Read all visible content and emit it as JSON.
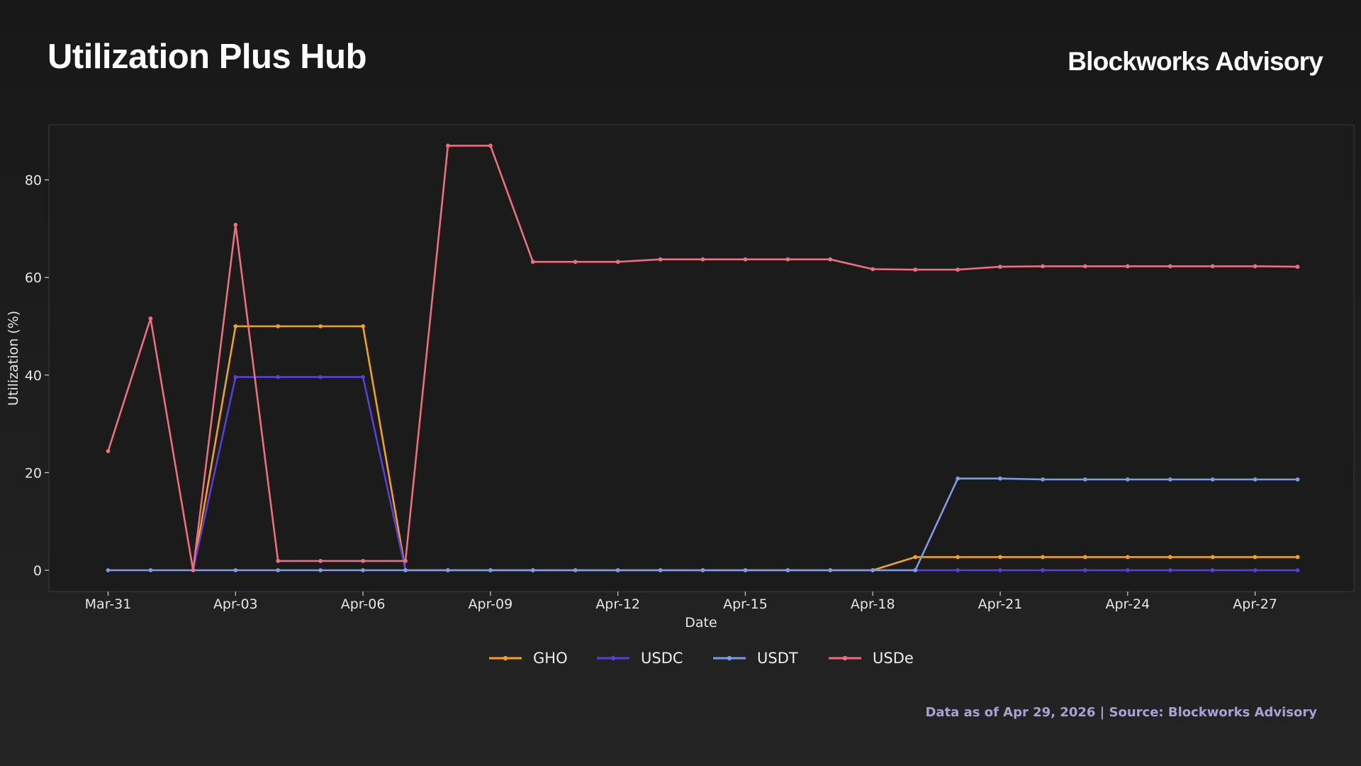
{
  "header": {
    "title": "Utilization Plus Hub",
    "brand": "Blockworks Advisory"
  },
  "footer": {
    "source_note": "Data as of Apr 29, 2026 | Source: Blockworks Advisory"
  },
  "colors": {
    "GHO": "#f0a31c",
    "USDC": "#5b3ed6",
    "USDT": "#7c9de6",
    "USDe": "#ec6f7e"
  },
  "chart_data": {
    "type": "line",
    "xlabel": "Date",
    "ylabel": "Utilization (%)",
    "ylim": [
      -4.3,
      91
    ],
    "yticks": [
      0,
      20,
      40,
      60,
      80
    ],
    "xticks": [
      {
        "label": "Mar-31",
        "date": "2026-03-31"
      },
      {
        "label": "Apr-03",
        "date": "2026-04-03"
      },
      {
        "label": "Apr-06",
        "date": "2026-04-06"
      },
      {
        "label": "Apr-09",
        "date": "2026-04-09"
      },
      {
        "label": "Apr-12",
        "date": "2026-04-12"
      },
      {
        "label": "Apr-15",
        "date": "2026-04-15"
      },
      {
        "label": "Apr-18",
        "date": "2026-04-18"
      },
      {
        "label": "Apr-21",
        "date": "2026-04-21"
      },
      {
        "label": "Apr-24",
        "date": "2026-04-24"
      },
      {
        "label": "Apr-27",
        "date": "2026-04-27"
      }
    ],
    "x": [
      "2026-03-31",
      "2026-04-01",
      "2026-04-02",
      "2026-04-03",
      "2026-04-04",
      "2026-04-05",
      "2026-04-06",
      "2026-04-07",
      "2026-04-08",
      "2026-04-09",
      "2026-04-10",
      "2026-04-11",
      "2026-04-12",
      "2026-04-13",
      "2026-04-14",
      "2026-04-15",
      "2026-04-16",
      "2026-04-17",
      "2026-04-18",
      "2026-04-19",
      "2026-04-20",
      "2026-04-21",
      "2026-04-22",
      "2026-04-23",
      "2026-04-24",
      "2026-04-25",
      "2026-04-26",
      "2026-04-27",
      "2026-04-28"
    ],
    "grid": false,
    "legend": "bottom-center",
    "series": [
      {
        "name": "GHO",
        "x": [
          "2026-04-02",
          "2026-04-03",
          "2026-04-04",
          "2026-04-05",
          "2026-04-06",
          "2026-04-07",
          "2026-04-08",
          "2026-04-09",
          "2026-04-10",
          "2026-04-11",
          "2026-04-12",
          "2026-04-13",
          "2026-04-14",
          "2026-04-15",
          "2026-04-16",
          "2026-04-17",
          "2026-04-18",
          "2026-04-19",
          "2026-04-20",
          "2026-04-21",
          "2026-04-22",
          "2026-04-23",
          "2026-04-24",
          "2026-04-25",
          "2026-04-26",
          "2026-04-27",
          "2026-04-28"
        ],
        "values": [
          0,
          50,
          50,
          50,
          50,
          0,
          0,
          0,
          0,
          0,
          0,
          0,
          0,
          0,
          0,
          0,
          0,
          2.7,
          2.7,
          2.7,
          2.7,
          2.7,
          2.7,
          2.7,
          2.7,
          2.7,
          2.7
        ]
      },
      {
        "name": "USDC",
        "x": [
          "2026-04-02",
          "2026-04-03",
          "2026-04-04",
          "2026-04-05",
          "2026-04-06",
          "2026-04-07",
          "2026-04-08",
          "2026-04-09",
          "2026-04-10",
          "2026-04-11",
          "2026-04-12",
          "2026-04-13",
          "2026-04-14",
          "2026-04-15",
          "2026-04-16",
          "2026-04-17",
          "2026-04-18",
          "2026-04-19",
          "2026-04-20",
          "2026-04-21",
          "2026-04-22",
          "2026-04-23",
          "2026-04-24",
          "2026-04-25",
          "2026-04-26",
          "2026-04-27",
          "2026-04-28"
        ],
        "values": [
          0,
          39.6,
          39.6,
          39.6,
          39.6,
          0,
          0,
          0,
          0,
          0,
          0,
          0,
          0,
          0,
          0,
          0,
          0,
          0,
          0,
          0,
          0,
          0,
          0,
          0,
          0,
          0,
          0
        ]
      },
      {
        "name": "USDT",
        "x": [
          "2026-03-31",
          "2026-04-01",
          "2026-04-02",
          "2026-04-03",
          "2026-04-04",
          "2026-04-05",
          "2026-04-06",
          "2026-04-07",
          "2026-04-08",
          "2026-04-09",
          "2026-04-10",
          "2026-04-11",
          "2026-04-12",
          "2026-04-13",
          "2026-04-14",
          "2026-04-15",
          "2026-04-16",
          "2026-04-17",
          "2026-04-18",
          "2026-04-19",
          "2026-04-20",
          "2026-04-21",
          "2026-04-22",
          "2026-04-23",
          "2026-04-24",
          "2026-04-25",
          "2026-04-26",
          "2026-04-27",
          "2026-04-28"
        ],
        "values": [
          0,
          0,
          0,
          0,
          0,
          0,
          0,
          0,
          0,
          0,
          0,
          0,
          0,
          0,
          0,
          0,
          0,
          0,
          0,
          0,
          18.8,
          18.8,
          18.6,
          18.6,
          18.6,
          18.6,
          18.6,
          18.6,
          18.6
        ]
      },
      {
        "name": "USDe",
        "x": [
          "2026-03-31",
          "2026-04-01",
          "2026-04-02",
          "2026-04-03",
          "2026-04-04",
          "2026-04-05",
          "2026-04-06",
          "2026-04-07",
          "2026-04-08",
          "2026-04-09",
          "2026-04-10",
          "2026-04-11",
          "2026-04-12",
          "2026-04-13",
          "2026-04-14",
          "2026-04-15",
          "2026-04-16",
          "2026-04-17",
          "2026-04-18",
          "2026-04-19",
          "2026-04-20",
          "2026-04-21",
          "2026-04-22",
          "2026-04-23",
          "2026-04-24",
          "2026-04-25",
          "2026-04-26",
          "2026-04-27",
          "2026-04-28"
        ],
        "values": [
          24.4,
          51.6,
          0,
          70.8,
          1.9,
          1.9,
          1.9,
          1.9,
          87,
          87,
          63.2,
          63.2,
          63.2,
          63.7,
          63.7,
          63.7,
          63.7,
          63.7,
          61.7,
          61.6,
          61.6,
          62.2,
          62.3,
          62.3,
          62.3,
          62.3,
          62.3,
          62.3,
          62.2
        ]
      }
    ]
  }
}
